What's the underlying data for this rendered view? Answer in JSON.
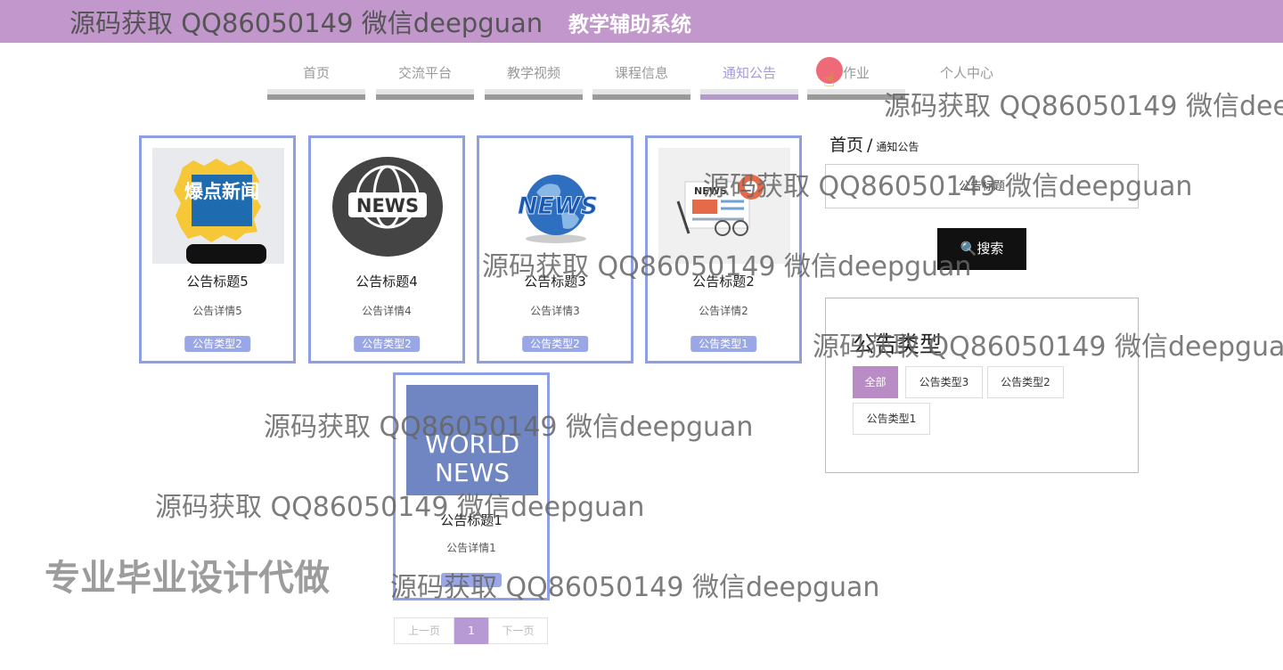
{
  "header": {
    "watermark": "源码获取 QQ86050149 微信deepguan",
    "system_title": "教学辅助系统"
  },
  "nav": [
    {
      "label": "首页"
    },
    {
      "label": "交流平台"
    },
    {
      "label": "教学视频"
    },
    {
      "label": "课程信息"
    },
    {
      "label": "通知公告",
      "active": true
    },
    {
      "label": "作业"
    },
    {
      "label": "个人中心"
    }
  ],
  "cards": [
    {
      "title": "公告标题5",
      "detail": "公告详情5",
      "type": "公告类型2",
      "image": "explosive-news-icon",
      "image_text": "爆点新闻"
    },
    {
      "title": "公告标题4",
      "detail": "公告详情4",
      "type": "公告类型2",
      "image": "news-globe-icon",
      "image_text": "NEWS"
    },
    {
      "title": "公告标题3",
      "detail": "公告详情3",
      "type": "公告类型2",
      "image": "globe-news-3d-icon",
      "image_text": "NEWS"
    },
    {
      "title": "公告标题2",
      "detail": "公告详情2",
      "type": "公告类型1",
      "image": "newspaper-glasses-icon",
      "image_text": "NEWS"
    },
    {
      "title": "公告标题1",
      "detail": "公告详情1",
      "type": "",
      "image": "world-news-icon",
      "image_text_line1": "WORLD",
      "image_text_line2": "NEWS"
    }
  ],
  "breadcrumb": {
    "home": "首页",
    "separator": "/",
    "current": "通知公告"
  },
  "search": {
    "placeholder": "公告标题",
    "button": "搜索"
  },
  "types": {
    "title": "公告类型",
    "options": [
      "全部",
      "公告类型3",
      "公告类型2",
      "公告类型1"
    ],
    "selected": "全部"
  },
  "pagination": {
    "prev": "上一页",
    "current": "1",
    "next": "下一页"
  },
  "overlay": {
    "watermark": "源码获取 QQ86050149 微信deepguan",
    "slogan": "专业毕业设计代做"
  },
  "colors": {
    "topbar": "#c197cc",
    "card_border": "#8fa0e2",
    "type_badge": "#9aa7e6",
    "accent": "#b98cc6"
  }
}
